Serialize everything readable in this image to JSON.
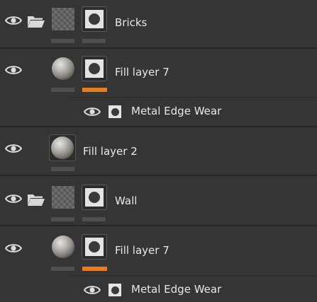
{
  "layers": [
    {
      "name": "Bricks"
    },
    {
      "name": "Fill layer 7"
    },
    {
      "name": "Metal Edge Wear"
    },
    {
      "name": "Fill layer 2"
    },
    {
      "name": "Wall"
    },
    {
      "name": "Fill layer 7"
    },
    {
      "name": "Metal Edge Wear"
    }
  ],
  "colors": {
    "background": "#353535",
    "accent": "#e87c1e"
  },
  "icons": [
    "eye-icon",
    "folder-icon",
    "mask-icon",
    "material-sphere"
  ]
}
